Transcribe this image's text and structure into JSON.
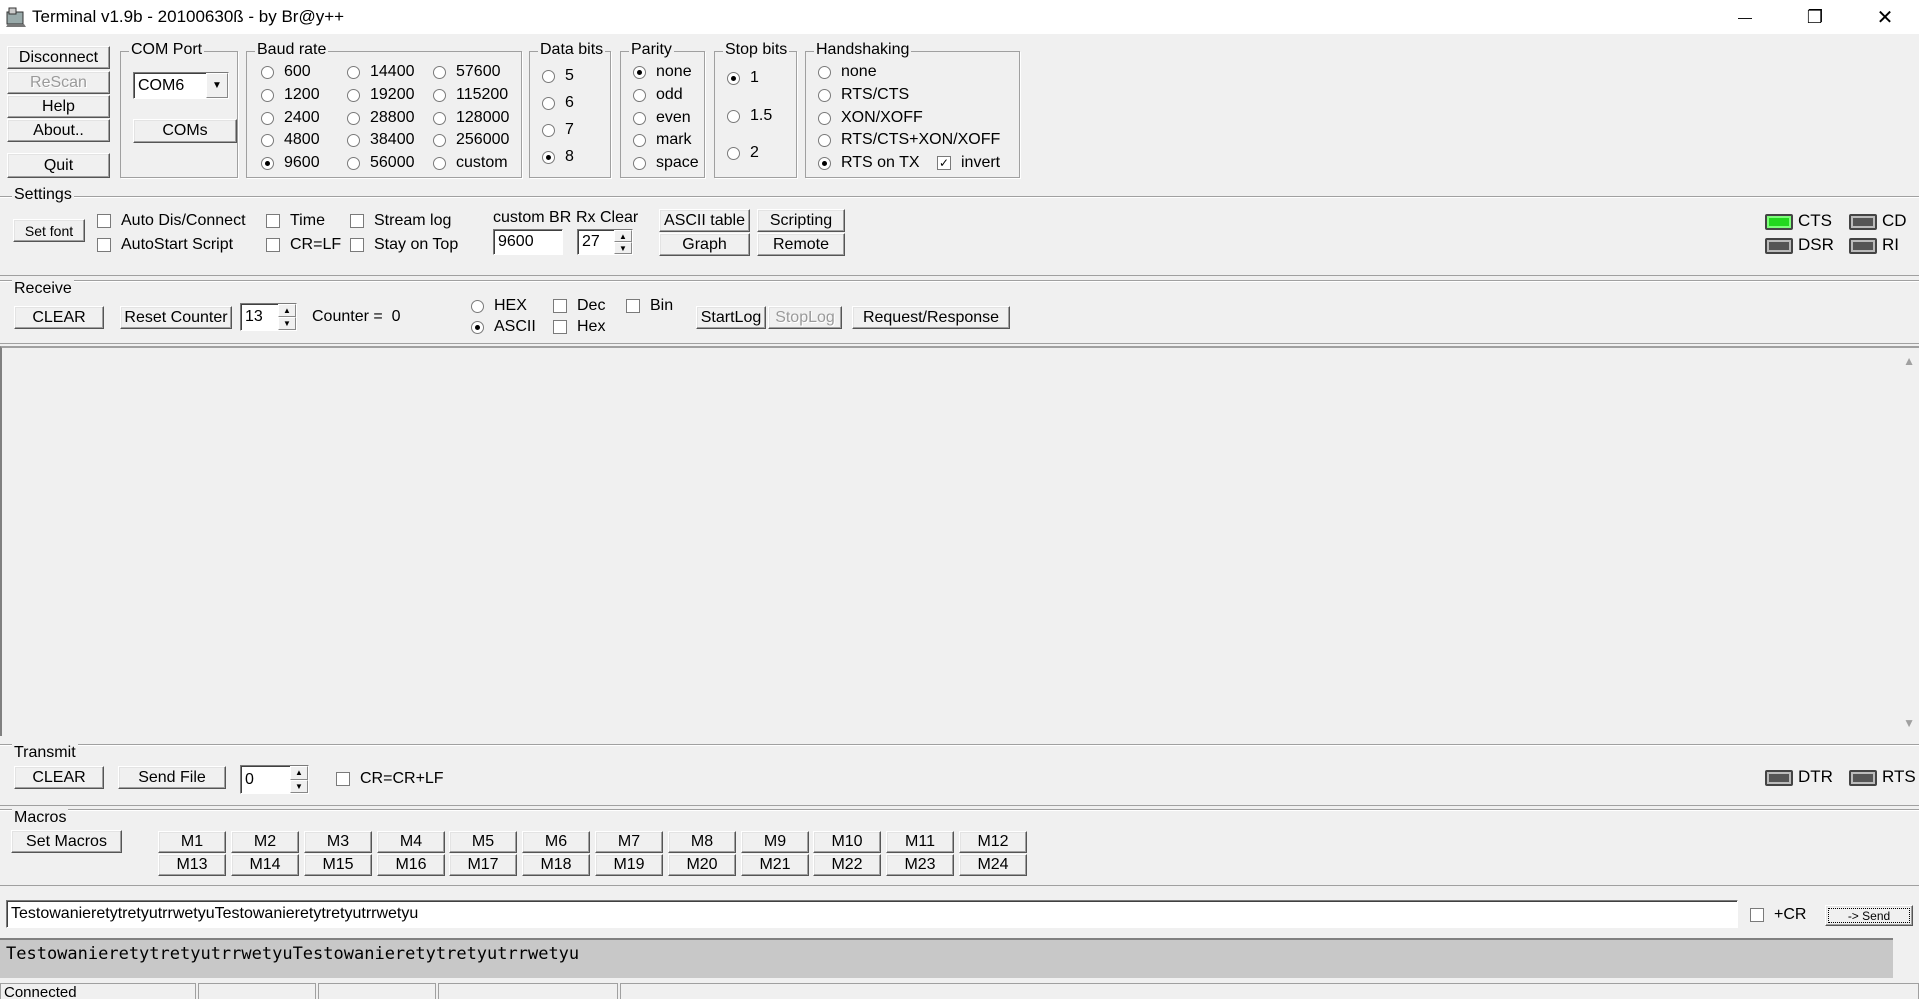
{
  "window": {
    "title": "Terminal v1.9b - 20100630ß - by Br@y++",
    "minimize_glyph": "—",
    "restore_glyph": "❐",
    "close_glyph": "✕",
    "icon": "terminal-app-icon"
  },
  "conn": {
    "disconnect": "Disconnect",
    "rescan": "ReScan",
    "help": "Help",
    "about": "About..",
    "quit": "Quit"
  },
  "com_port": {
    "label": "COM Port",
    "value": "COM6",
    "coms": "COMs"
  },
  "baud": {
    "label": "Baud rate",
    "options": [
      "600",
      "1200",
      "2400",
      "4800",
      "9600",
      "14400",
      "19200",
      "28800",
      "38400",
      "56000",
      "57600",
      "115200",
      "128000",
      "256000",
      "custom"
    ],
    "selected": "9600"
  },
  "data_bits": {
    "label": "Data bits",
    "options": [
      "5",
      "6",
      "7",
      "8"
    ],
    "selected": "8"
  },
  "parity": {
    "label": "Parity",
    "options": [
      "none",
      "odd",
      "even",
      "mark",
      "space"
    ],
    "selected": "none"
  },
  "stop_bits": {
    "label": "Stop bits",
    "options": [
      "1",
      "1.5",
      "2"
    ],
    "selected": "1"
  },
  "handshaking": {
    "label": "Handshaking",
    "options": [
      "none",
      "RTS/CTS",
      "XON/XOFF",
      "RTS/CTS+XON/XOFF",
      "RTS on TX"
    ],
    "selected": "RTS on TX",
    "invert_label": "invert",
    "invert_checked": true
  },
  "settings": {
    "label": "Settings",
    "set_font": "Set font",
    "auto_dis_connect": "Auto Dis/Connect",
    "autostart_script": "AutoStart Script",
    "time": "Time",
    "cr_lf": "CR=LF",
    "stream_log": "Stream log",
    "stay_on_top": "Stay on Top",
    "custom_br_label": "custom BR",
    "custom_br_value": "9600",
    "rx_clear_label": "Rx Clear",
    "rx_clear_value": "27",
    "ascii_table": "ASCII table",
    "scripting": "Scripting",
    "graph": "Graph",
    "remote": "Remote",
    "leds": {
      "cts": "CTS",
      "cd": "CD",
      "dsr": "DSR",
      "ri": "RI"
    },
    "cts_active": true
  },
  "receive": {
    "label": "Receive",
    "clear": "CLEAR",
    "reset_counter": "Reset Counter",
    "counter_spin": "13",
    "counter_text": "Counter =  0",
    "hex": "HEX",
    "ascii": "ASCII",
    "mode_selected": "ASCII",
    "dec": "Dec",
    "hex_chk": "Hex",
    "bin": "Bin",
    "start_log": "StartLog",
    "stop_log": "StopLog",
    "request_response": "Request/Response",
    "scroll_up": "▲",
    "scroll_down": "▼"
  },
  "transmit": {
    "label": "Transmit",
    "clear": "CLEAR",
    "send_file": "Send File",
    "spin_value": "0",
    "cr_crlf": "CR=CR+LF",
    "dtr": "DTR",
    "rts": "RTS"
  },
  "macros": {
    "label": "Macros",
    "set_macros": "Set Macros",
    "row1": [
      "M1",
      "M2",
      "M3",
      "M4",
      "M5",
      "M6",
      "M7",
      "M8",
      "M9",
      "M10",
      "M11",
      "M12"
    ],
    "row2": [
      "M13",
      "M14",
      "M15",
      "M16",
      "M17",
      "M18",
      "M19",
      "M20",
      "M21",
      "M22",
      "M23",
      "M24"
    ]
  },
  "send_bar": {
    "input_value": "TestowanieretytretyutrrwetyuTestowanieretytretyutrrwetyu",
    "plus_cr": "+CR",
    "send": "-> Send"
  },
  "transmit_display": {
    "text": "TestowanieretytretyutrrwetyuTestowanieretytretyutrrwetyu"
  },
  "status": {
    "state": "Connected"
  }
}
